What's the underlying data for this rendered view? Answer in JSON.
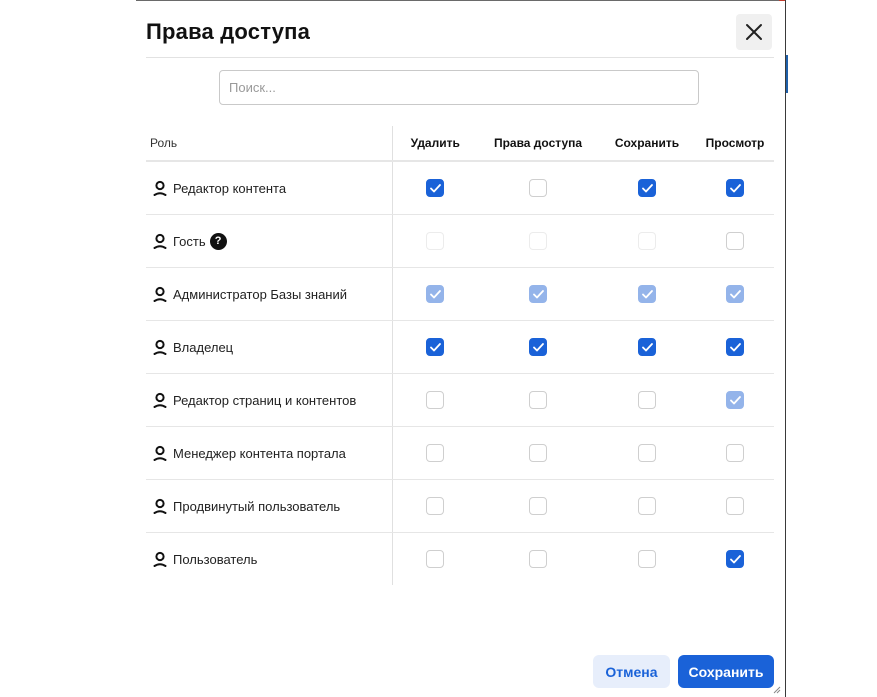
{
  "dialog": {
    "title": "Права доступа",
    "close_icon": "close-icon"
  },
  "search": {
    "placeholder": "Поиск...",
    "value": ""
  },
  "table": {
    "role_header": "Роль",
    "columns": [
      "Удалить",
      "Права доступа",
      "Сохранить",
      "Просмотр"
    ],
    "rows": [
      {
        "label": "Редактор контента",
        "help": false,
        "cells": [
          "checked",
          "unchecked",
          "checked",
          "checked"
        ]
      },
      {
        "label": "Гость",
        "help": true,
        "cells": [
          "disabled",
          "disabled",
          "disabled",
          "unchecked"
        ]
      },
      {
        "label": "Администратор Базы знаний",
        "help": false,
        "cells": [
          "checked-disabled",
          "checked-disabled",
          "checked-disabled",
          "checked-disabled"
        ]
      },
      {
        "label": "Владелец",
        "help": false,
        "cells": [
          "checked",
          "checked",
          "checked",
          "checked"
        ]
      },
      {
        "label": "Редактор страниц и контентов",
        "help": false,
        "cells": [
          "unchecked",
          "unchecked",
          "unchecked",
          "checked-disabled"
        ]
      },
      {
        "label": "Менеджер контента портала",
        "help": false,
        "cells": [
          "unchecked",
          "unchecked",
          "unchecked",
          "unchecked"
        ]
      },
      {
        "label": "Продвинутый пользователь",
        "help": false,
        "cells": [
          "unchecked",
          "unchecked",
          "unchecked",
          "unchecked"
        ]
      },
      {
        "label": "Пользователь",
        "help": false,
        "cells": [
          "unchecked",
          "unchecked",
          "unchecked",
          "checked"
        ]
      }
    ],
    "help_glyph": "?"
  },
  "footer": {
    "cancel_label": "Отмена",
    "save_label": "Сохранить"
  },
  "colors": {
    "accent": "#1a62d8",
    "accent_light": "#94b4ea",
    "cancel_bg": "#e7eefb"
  }
}
